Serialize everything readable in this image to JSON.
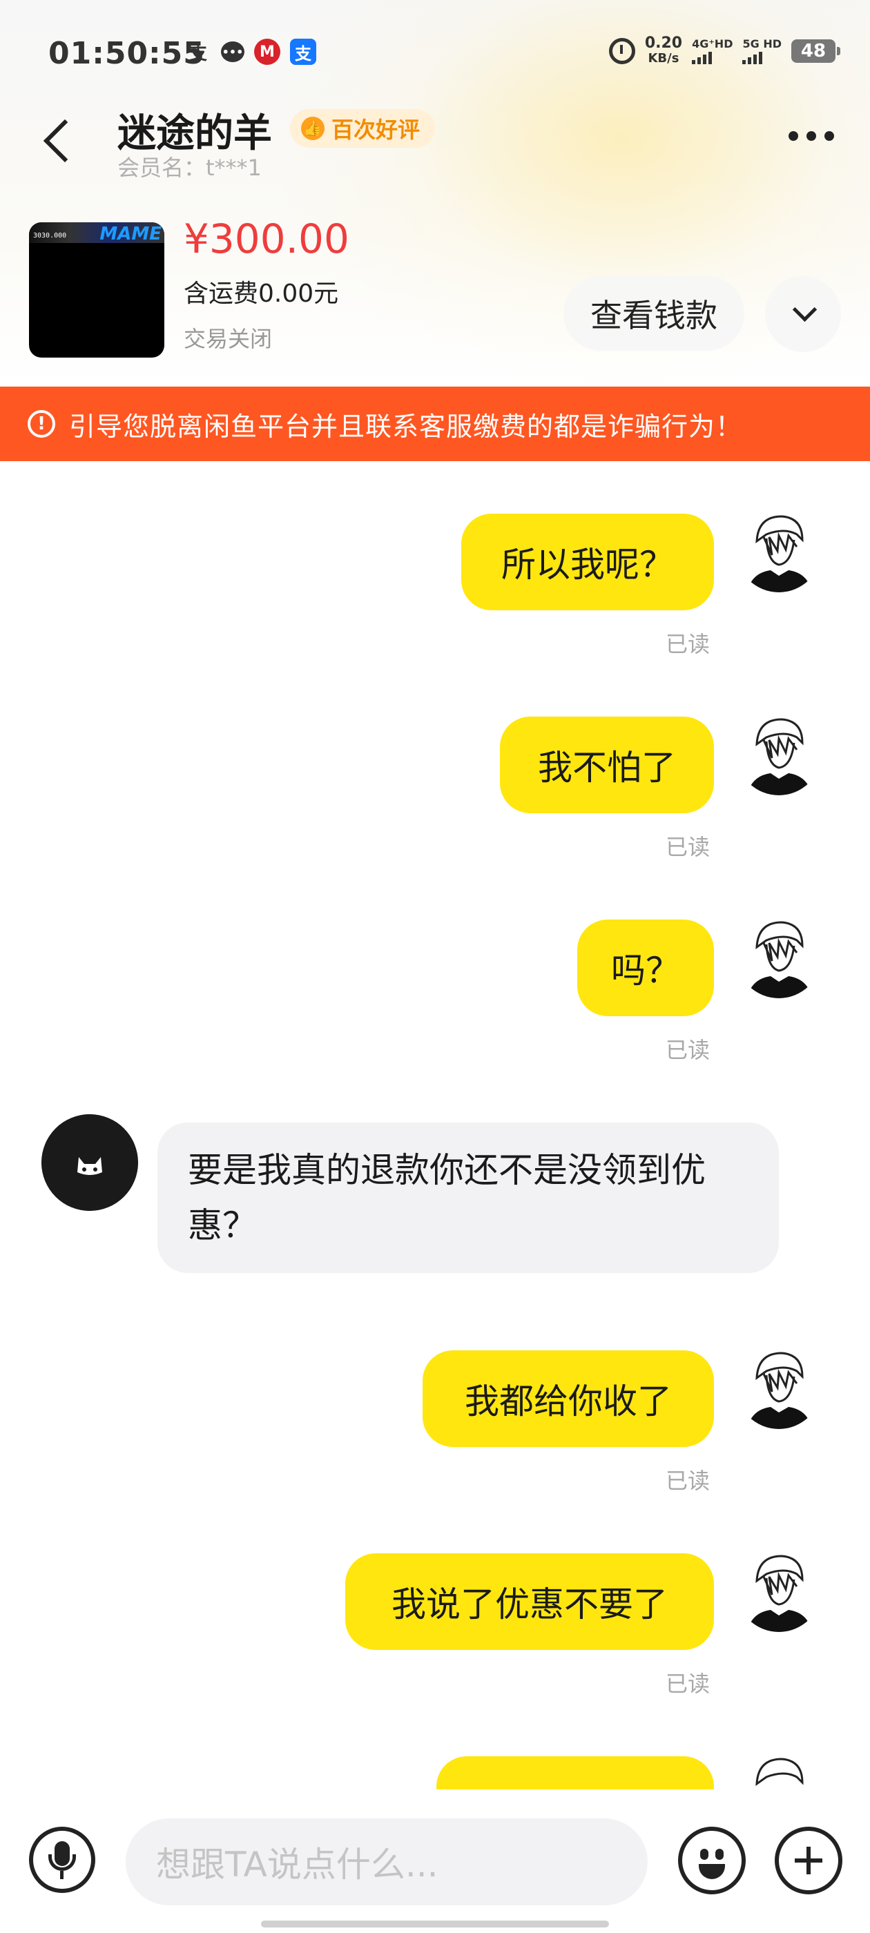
{
  "status_bar": {
    "time": "01:50:55",
    "net_speed_value": "0.20",
    "net_speed_unit": "KB/s",
    "sim1": "4G⁺HD",
    "sim2": "5G HD",
    "battery": "48"
  },
  "header": {
    "peer_name": "迷途的羊",
    "badge_label": "百次好评",
    "member_id": "会员名：t***1"
  },
  "product": {
    "price": "¥300.00",
    "shipping": "含运费0.00元",
    "status": "交易关闭",
    "view_payment_label": "查看钱款",
    "thumb_text": "MAME",
    "thumb_score": "3030.000"
  },
  "warning": {
    "text": "引导您脱离闲鱼平台并且联系客服缴费的都是诈骗行为！"
  },
  "messages": [
    {
      "from": "me",
      "text": "所以我呢？",
      "read": "已读"
    },
    {
      "from": "me",
      "text": "我不怕了",
      "read": "已读"
    },
    {
      "from": "me",
      "text": "吗？",
      "read": "已读"
    },
    {
      "from": "peer",
      "text": "要是我真的退款你还不是没领到优惠？"
    },
    {
      "from": "me",
      "text": "我都给你收了",
      "read": "已读"
    },
    {
      "from": "me",
      "text": "我说了优惠不要了",
      "read": "已读"
    }
  ],
  "input": {
    "placeholder": "想跟TA说点什么..."
  },
  "colors": {
    "my_bubble": "#ffe60f",
    "peer_bubble": "#f2f2f4",
    "warning": "#ff5722",
    "price": "#ee3d3d",
    "badge_text": "#f28c00"
  },
  "icons": [
    "back-icon",
    "more-icon",
    "thumbs-up-icon",
    "warning-icon",
    "chevron-down-icon",
    "mic-icon",
    "emoji-icon",
    "add-icon"
  ]
}
